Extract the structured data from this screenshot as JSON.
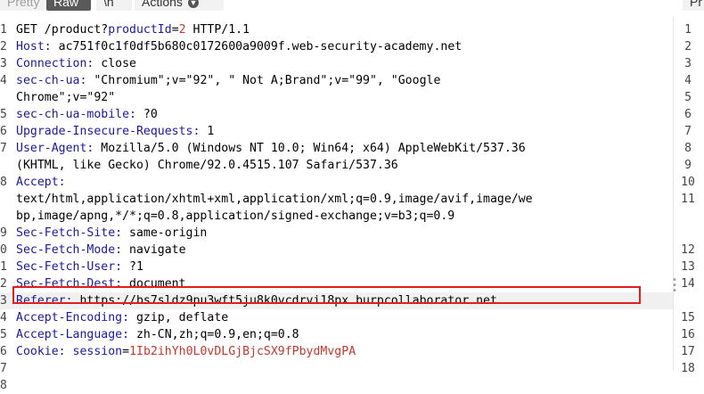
{
  "toolbar": {
    "pretty_label": "Pretty",
    "raw_label": "Raw",
    "newline_label": "\\n",
    "actions_label": "Actions",
    "right_label": "Pr"
  },
  "request": {
    "lines": [
      {
        "ln": "1",
        "parts": [
          {
            "t": "GET /product?",
            "c": ""
          },
          {
            "t": "productId",
            "c": "param"
          },
          {
            "t": "=",
            "c": ""
          },
          {
            "t": "2",
            "c": "val"
          },
          {
            "t": " HTTP/1.1",
            "c": ""
          }
        ]
      },
      {
        "ln": "2",
        "parts": [
          {
            "t": "Host:",
            "c": "key"
          },
          {
            "t": " ac751f0c1f0df5b680c0172600a9009f.web-security-academy.net",
            "c": ""
          }
        ]
      },
      {
        "ln": "3",
        "parts": [
          {
            "t": "Connection:",
            "c": "key"
          },
          {
            "t": " close",
            "c": ""
          }
        ]
      },
      {
        "ln": "4",
        "parts": [
          {
            "t": "sec-ch-ua:",
            "c": "key"
          },
          {
            "t": " \"Chromium\";v=\"92\", \" Not A;Brand\";v=\"99\", \"Google",
            "c": ""
          }
        ]
      },
      {
        "ln": "",
        "parts": [
          {
            "t": "Chrome\";v=\"92\"",
            "c": ""
          }
        ]
      },
      {
        "ln": "5",
        "parts": [
          {
            "t": "sec-ch-ua-mobile:",
            "c": "key"
          },
          {
            "t": " ?0",
            "c": ""
          }
        ]
      },
      {
        "ln": "6",
        "parts": [
          {
            "t": "Upgrade-Insecure-Requests:",
            "c": "key"
          },
          {
            "t": " 1",
            "c": ""
          }
        ]
      },
      {
        "ln": "7",
        "parts": [
          {
            "t": "User-Agent:",
            "c": "key"
          },
          {
            "t": " Mozilla/5.0 (Windows NT 10.0; Win64; x64) AppleWebKit/537.36",
            "c": ""
          }
        ]
      },
      {
        "ln": "",
        "parts": [
          {
            "t": "(KHTML, like Gecko) Chrome/92.0.4515.107 Safari/537.36",
            "c": ""
          }
        ]
      },
      {
        "ln": "8",
        "parts": [
          {
            "t": "Accept:",
            "c": "key"
          }
        ]
      },
      {
        "ln": "",
        "parts": [
          {
            "t": "text/html,application/xhtml+xml,application/xml;q=0.9,image/avif,image/we",
            "c": ""
          }
        ]
      },
      {
        "ln": "",
        "parts": [
          {
            "t": "bp,image/apng,*/*;q=0.8,application/signed-exchange;v=b3;q=0.9",
            "c": ""
          }
        ]
      },
      {
        "ln": "9",
        "parts": [
          {
            "t": "Sec-Fetch-Site:",
            "c": "key"
          },
          {
            "t": " same-origin",
            "c": ""
          }
        ]
      },
      {
        "ln": "0",
        "parts": [
          {
            "t": "Sec-Fetch-Mode:",
            "c": "key"
          },
          {
            "t": " navigate",
            "c": ""
          }
        ]
      },
      {
        "ln": "1",
        "parts": [
          {
            "t": "Sec-Fetch-User:",
            "c": "key"
          },
          {
            "t": " ?1",
            "c": ""
          }
        ]
      },
      {
        "ln": "2",
        "parts": [
          {
            "t": "Sec-Fetch-Dest:",
            "c": "key"
          },
          {
            "t": " document",
            "c": ""
          }
        ]
      },
      {
        "ln": "3",
        "parts": [
          {
            "t": "Referer:",
            "c": "key"
          },
          {
            "t": " https://bs7sldz9pu3wft5ju8k0vcdrvi18px.burpcollaborator.net",
            "c": ""
          }
        ]
      },
      {
        "ln": "4",
        "parts": [
          {
            "t": "Accept-Encoding:",
            "c": "key"
          },
          {
            "t": " gzip, deflate",
            "c": ""
          }
        ]
      },
      {
        "ln": "5",
        "parts": [
          {
            "t": "Accept-Language:",
            "c": "key"
          },
          {
            "t": " zh-CN,zh;q=0.9,en;q=0.8",
            "c": ""
          }
        ]
      },
      {
        "ln": "6",
        "parts": [
          {
            "t": "Cookie:",
            "c": "key"
          },
          {
            "t": " session",
            "c": "param"
          },
          {
            "t": "=",
            "c": ""
          },
          {
            "t": "1Ib2ihYh0L0vDLGjBjcSX9fPbydMvgPA",
            "c": "val"
          }
        ]
      },
      {
        "ln": "7",
        "parts": []
      },
      {
        "ln": "8",
        "parts": []
      }
    ]
  },
  "right_gutter": [
    {
      "n": "1",
      "row": 0
    },
    {
      "n": "2",
      "row": 1
    },
    {
      "n": "3",
      "row": 2
    },
    {
      "n": "4",
      "row": 3
    },
    {
      "n": "5",
      "row": 4
    },
    {
      "n": "6",
      "row": 5
    },
    {
      "n": "7",
      "row": 6
    },
    {
      "n": "8",
      "row": 7
    },
    {
      "n": "9",
      "row": 8
    },
    {
      "n": "10",
      "row": 9
    },
    {
      "n": "11",
      "row": 10
    },
    {
      "n": "12",
      "row": 13
    },
    {
      "n": "13",
      "row": 14
    },
    {
      "n": "14",
      "row": 15
    },
    {
      "n": "15",
      "row": 17
    },
    {
      "n": "16",
      "row": 18
    },
    {
      "n": "17",
      "row": 19
    },
    {
      "n": "18",
      "row": 20
    }
  ]
}
